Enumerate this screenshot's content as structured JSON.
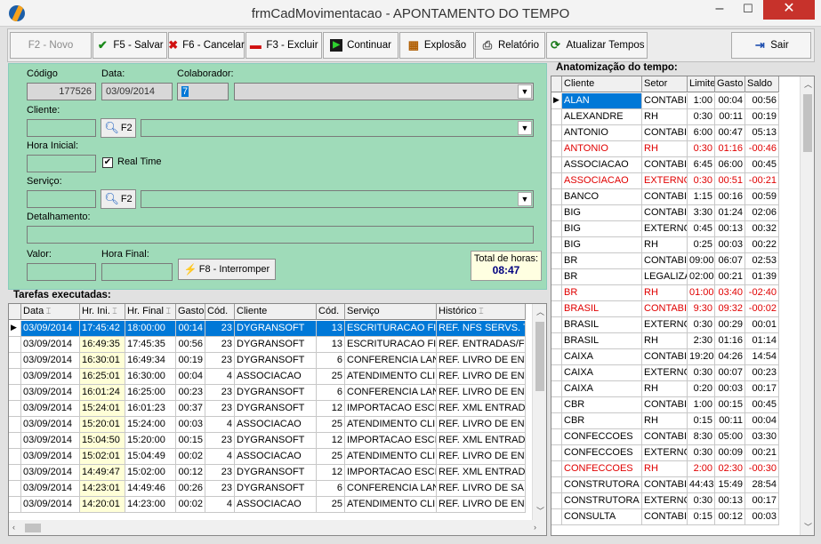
{
  "window": {
    "title": "frmCadMovimentacao - APONTAMENTO DO TEMPO",
    "min": "–",
    "max": "☐",
    "close": "✕"
  },
  "toolbar": {
    "novo": "F2 - Novo",
    "salvar": "F5 - Salvar",
    "cancelar": "F6 - Cancelar",
    "excluir": "F3 - Excluir",
    "continuar": "Continuar",
    "explosao": "Explosão",
    "relatorio": "Relatório",
    "atualizar": "Atualizar Tempos",
    "sair": "Sair"
  },
  "form": {
    "codigo_label": "Código",
    "codigo": "177526",
    "data_label": "Data:",
    "data": "03/09/2014",
    "colaborador_label": "Colaborador:",
    "colaborador": "7",
    "cliente_label": "Cliente:",
    "hora_inicial_label": "Hora Inicial:",
    "real_time_label": "Real Time",
    "real_time_checked": "✔",
    "servico_label": "Serviço:",
    "detalhamento_label": "Detalhamento:",
    "valor_label": "Valor:",
    "hora_final_label": "Hora Final:",
    "f2_label": "F2",
    "interromper": "F8 - Interromper",
    "total_label": "Total de horas:",
    "total_value": "08:47"
  },
  "tarefas": {
    "title": "Tarefas executadas:",
    "columns": [
      "Data",
      "Hr. Ini.",
      "Hr. Final",
      "Gasto",
      "Cód.",
      "Cliente",
      "Cód.",
      "Serviço",
      "Histórico"
    ],
    "rows": [
      [
        "03/09/2014",
        "17:45:42",
        "18:00:00",
        "00:14",
        "23",
        "DYGRANSOFT",
        "13",
        "ESCRITURACAO FI:",
        "REF. NFS SERVS. T"
      ],
      [
        "03/09/2014",
        "16:49:35",
        "17:45:35",
        "00:56",
        "23",
        "DYGRANSOFT",
        "13",
        "ESCRITURACAO FI:",
        "REF. ENTRADAS/FI"
      ],
      [
        "03/09/2014",
        "16:30:01",
        "16:49:34",
        "00:19",
        "23",
        "DYGRANSOFT",
        "6",
        "CONFERENCIA LAN",
        "REF. LIVRO DE ENT"
      ],
      [
        "03/09/2014",
        "16:25:01",
        "16:30:00",
        "00:04",
        "4",
        "ASSOCIACAO",
        "25",
        "ATENDIMENTO CLI",
        "REF. LIVRO DE ENT"
      ],
      [
        "03/09/2014",
        "16:01:24",
        "16:25:00",
        "00:23",
        "23",
        "DYGRANSOFT",
        "6",
        "CONFERENCIA LAN",
        "REF. LIVRO DE ENT"
      ],
      [
        "03/09/2014",
        "15:24:01",
        "16:01:23",
        "00:37",
        "23",
        "DYGRANSOFT",
        "12",
        "IMPORTACAO ESCI",
        "REF. XML ENTRAD/"
      ],
      [
        "03/09/2014",
        "15:20:01",
        "15:24:00",
        "00:03",
        "4",
        "ASSOCIACAO",
        "25",
        "ATENDIMENTO CLI",
        "REF. LIVRO DE ENT"
      ],
      [
        "03/09/2014",
        "15:04:50",
        "15:20:00",
        "00:15",
        "23",
        "DYGRANSOFT",
        "12",
        "IMPORTACAO ESCI",
        "REF. XML ENTRAD/"
      ],
      [
        "03/09/2014",
        "15:02:01",
        "15:04:49",
        "00:02",
        "4",
        "ASSOCIACAO",
        "25",
        "ATENDIMENTO CLI",
        "REF. LIVRO DE ENT"
      ],
      [
        "03/09/2014",
        "14:49:47",
        "15:02:00",
        "00:12",
        "23",
        "DYGRANSOFT",
        "12",
        "IMPORTACAO ESCI",
        "REF. XML ENTRAD/"
      ],
      [
        "03/09/2014",
        "14:23:01",
        "14:49:46",
        "00:26",
        "23",
        "DYGRANSOFT",
        "6",
        "CONFERENCIA LAN",
        "REF. LIVRO DE SAII"
      ],
      [
        "03/09/2014",
        "14:20:01",
        "14:23:00",
        "00:02",
        "4",
        "ASSOCIACAO",
        "25",
        "ATENDIMENTO CLI",
        "REF. LIVRO DE ENT"
      ]
    ]
  },
  "anatomia": {
    "title": "Anatomização do tempo:",
    "columns": [
      "Cliente",
      "Setor",
      "Limite",
      "Gasto",
      "Saldo"
    ],
    "rows": [
      [
        "ALAN",
        "CONTABI",
        "1:00",
        "00:04",
        "00:56",
        ""
      ],
      [
        "ALEXANDRE",
        "RH",
        "0:30",
        "00:11",
        "00:19",
        ""
      ],
      [
        "ANTONIO",
        "CONTABI",
        "6:00",
        "00:47",
        "05:13",
        ""
      ],
      [
        "ANTONIO",
        "RH",
        "0:30",
        "01:16",
        "-00:46",
        "red"
      ],
      [
        "ASSOCIACAO",
        "CONTABI",
        "6:45",
        "06:00",
        "00:45",
        ""
      ],
      [
        "ASSOCIACAO",
        "EXTERNO",
        "0:30",
        "00:51",
        "-00:21",
        "red"
      ],
      [
        "BANCO",
        "CONTABI",
        "1:15",
        "00:16",
        "00:59",
        ""
      ],
      [
        "BIG",
        "CONTABI",
        "3:30",
        "01:24",
        "02:06",
        ""
      ],
      [
        "BIG",
        "EXTERNO",
        "0:45",
        "00:13",
        "00:32",
        ""
      ],
      [
        "BIG",
        "RH",
        "0:25",
        "00:03",
        "00:22",
        ""
      ],
      [
        "BR",
        "CONTABI",
        "09:00",
        "06:07",
        "02:53",
        ""
      ],
      [
        "BR",
        "LEGALIZA",
        "02:00",
        "00:21",
        "01:39",
        ""
      ],
      [
        "BR",
        "RH",
        "01:00",
        "03:40",
        "-02:40",
        "red"
      ],
      [
        "BRASIL",
        "CONTABI",
        "9:30",
        "09:32",
        "-00:02",
        "red"
      ],
      [
        "BRASIL",
        "EXTERNO",
        "0:30",
        "00:29",
        "00:01",
        ""
      ],
      [
        "BRASIL",
        "RH",
        "2:30",
        "01:16",
        "01:14",
        ""
      ],
      [
        "CAIXA",
        "CONTABI",
        "19:20",
        "04:26",
        "14:54",
        ""
      ],
      [
        "CAIXA",
        "EXTERNO",
        "0:30",
        "00:07",
        "00:23",
        ""
      ],
      [
        "CAIXA",
        "RH",
        "0:20",
        "00:03",
        "00:17",
        ""
      ],
      [
        "CBR",
        "CONTABI",
        "1:00",
        "00:15",
        "00:45",
        ""
      ],
      [
        "CBR",
        "RH",
        "0:15",
        "00:11",
        "00:04",
        ""
      ],
      [
        "CONFECCOES",
        "CONTABI",
        "8:30",
        "05:00",
        "03:30",
        ""
      ],
      [
        "CONFECCOES",
        "EXTERNO",
        "0:30",
        "00:09",
        "00:21",
        ""
      ],
      [
        "CONFECCOES",
        "RH",
        "2:00",
        "02:30",
        "-00:30",
        "red"
      ],
      [
        "CONSTRUTORA",
        "CONTABI",
        "44:43",
        "15:49",
        "28:54",
        ""
      ],
      [
        "CONSTRUTORA",
        "EXTERNO",
        "0:30",
        "00:13",
        "00:17",
        ""
      ],
      [
        "CONSULTA",
        "CONTABI",
        "0:15",
        "00:12",
        "00:03",
        ""
      ]
    ]
  }
}
